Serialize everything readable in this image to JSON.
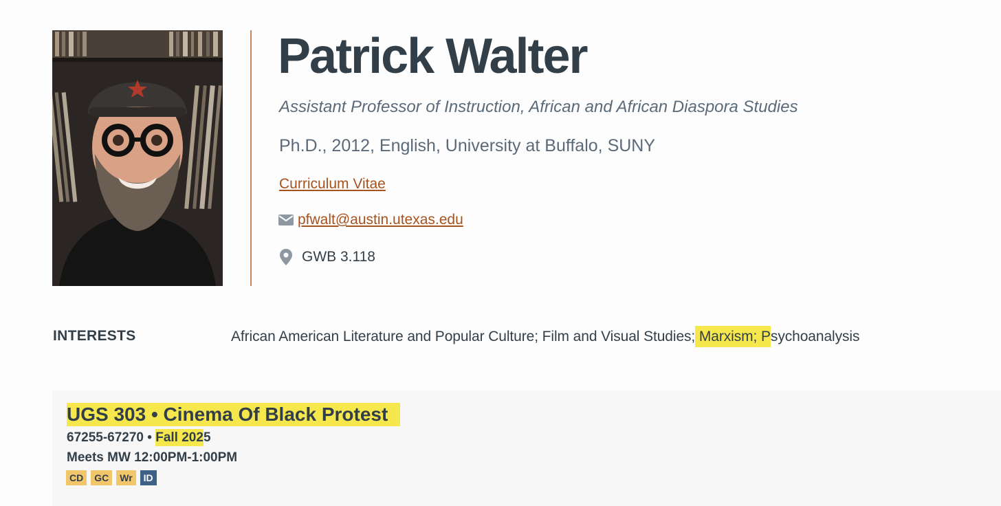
{
  "profile": {
    "name": "Patrick Walter",
    "title": "Assistant Professor of Instruction, African and African Diaspora Studies",
    "degree": "Ph.D., 2012, English, University at Buffalo, SUNY",
    "cv_label": "Curriculum Vitae",
    "email": "pfwalt@austin.utexas.edu",
    "office": "GWB 3.118",
    "email_icon": "envelope-icon",
    "office_icon": "map-pin-icon"
  },
  "interests": {
    "label": "INTERESTS",
    "text_before": "African American Literature and Popular Culture; Film and Visual Studies;",
    "text_highlighted": " Marxism; P",
    "text_after": "sychoanalysis"
  },
  "course": {
    "title": "UGS 303 • Cinema Of Black Protest",
    "numbers": "67255-67270",
    "separator": " • ",
    "semester_highlighted": "Fall 202",
    "semester_rest": "5",
    "meets": "Meets MW 12:00PM-1:00PM",
    "flags": [
      {
        "label": "CD",
        "color": "#f2c66b"
      },
      {
        "label": "GC",
        "color": "#f2c66b"
      },
      {
        "label": "Wr",
        "color": "#f2c66b"
      },
      {
        "label": "ID",
        "color": "#3e6286"
      }
    ]
  },
  "colors": {
    "accent_link": "#a6521d",
    "divider": "#c8845c",
    "highlight": "#f6e84c",
    "text": "#333f48"
  }
}
